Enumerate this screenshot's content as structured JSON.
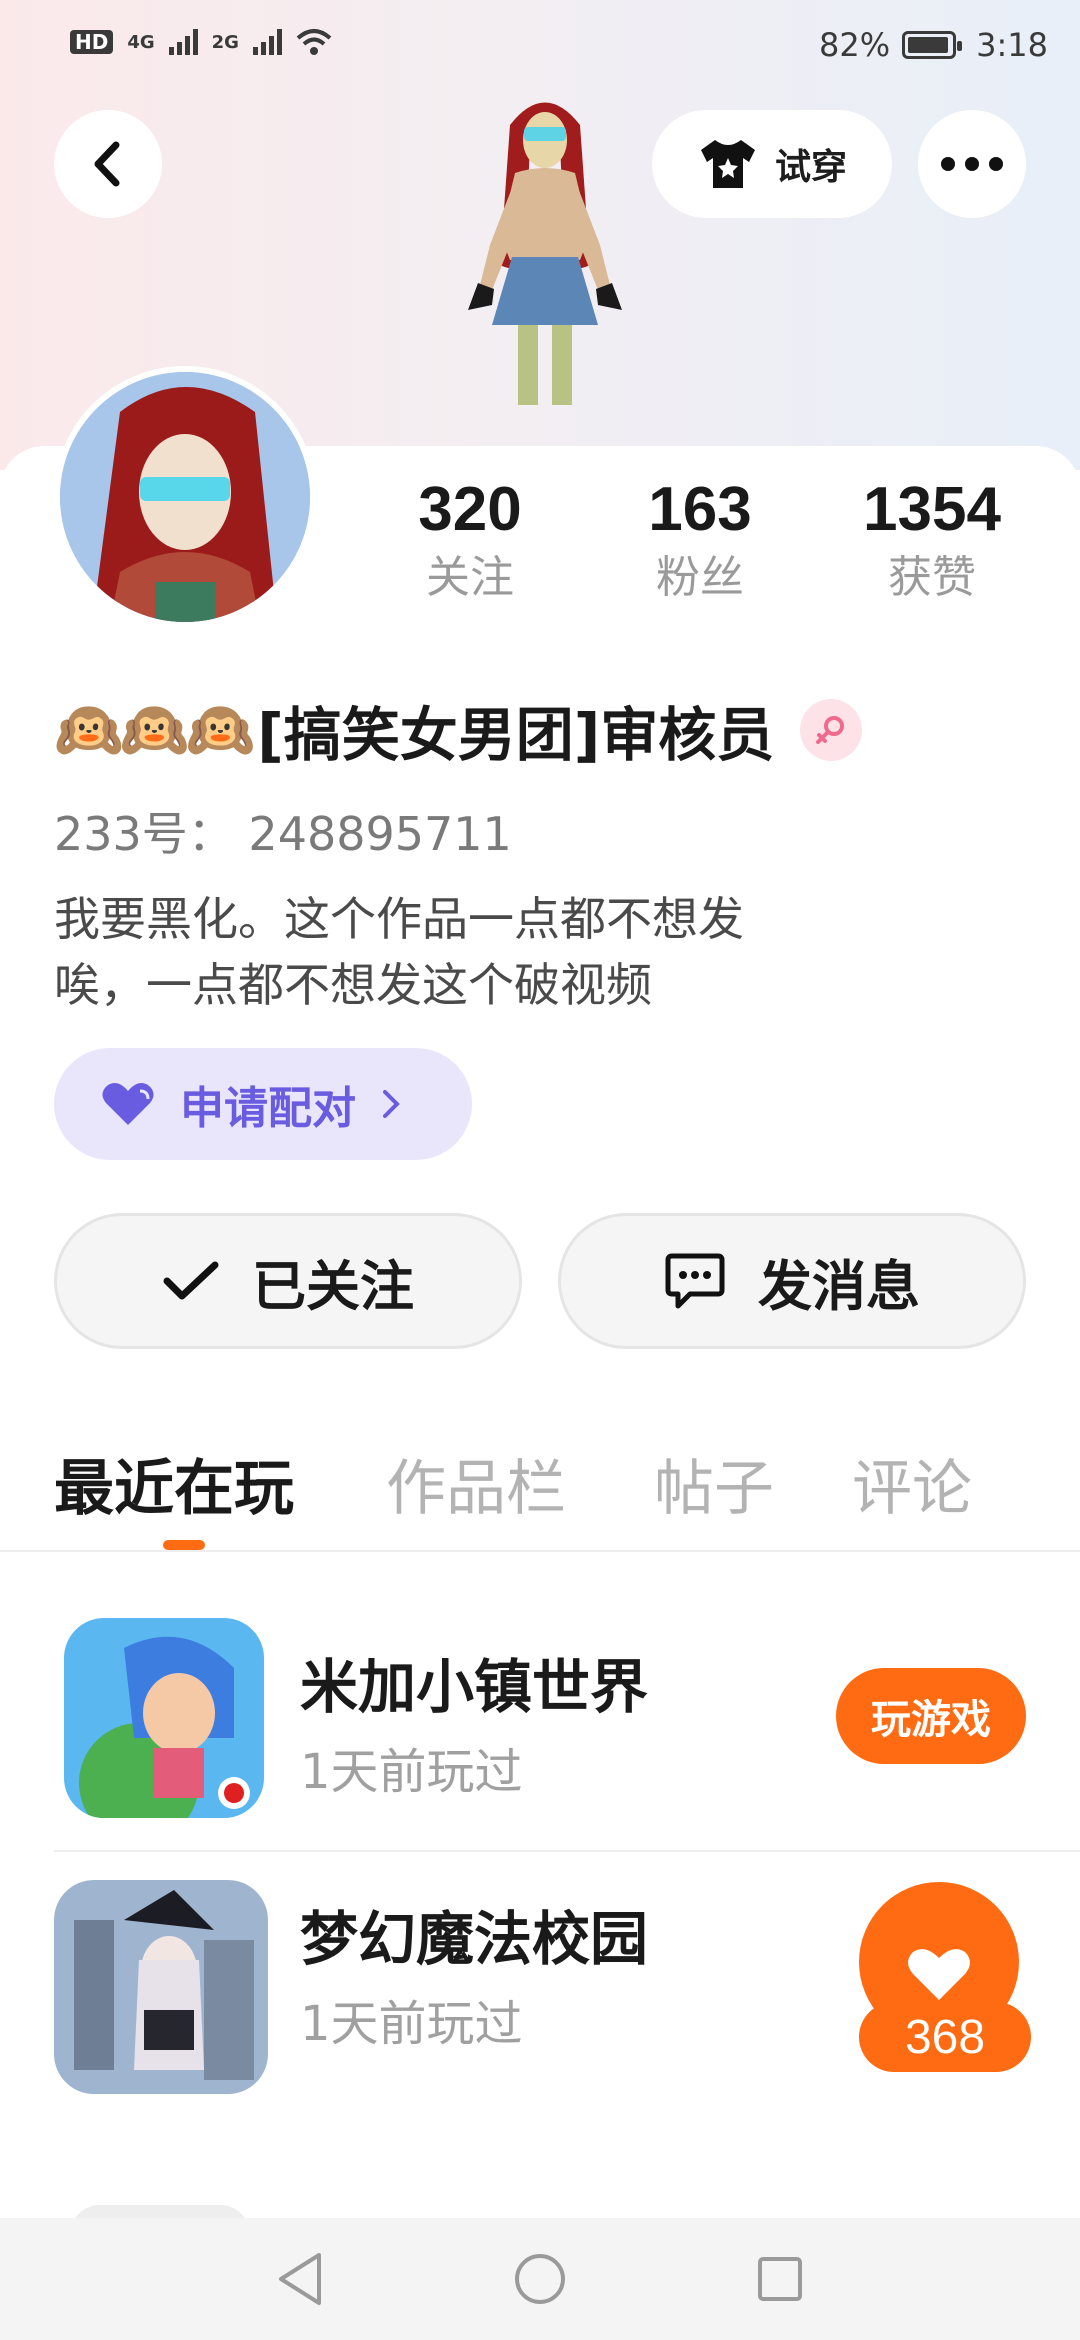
{
  "status_bar": {
    "hd": "HD",
    "sim1": "4G",
    "sim2": "2G",
    "battery": "82%",
    "battery_level": 0.82,
    "time": "3:18"
  },
  "header": {
    "back_icon": "chevron-left-icon",
    "tryon_label": "试穿",
    "tryon_icon": "tshirt-icon",
    "more_icon": "more-dots-icon"
  },
  "stats": [
    {
      "value": "320",
      "label": "关注"
    },
    {
      "value": "163",
      "label": "粉丝"
    },
    {
      "value": "1354",
      "label": "获赞"
    }
  ],
  "profile": {
    "name_prefix_emoji": "🙉🙉🙉",
    "name": "[搞笑女男团]审核员",
    "gender_icon": "female-icon",
    "uid": "233号：  248895711",
    "bio_line1": "我要黑化。这个作品一点都不想发",
    "bio_line2": "唉，一点都不想发这个破视频",
    "pair_label": "申请配对",
    "pair_icon": "heart-icon"
  },
  "actions": {
    "followed_label": "已关注",
    "message_label": "发消息"
  },
  "tabs": [
    {
      "label": "最近在玩",
      "active": true
    },
    {
      "label": "作品栏",
      "active": false
    },
    {
      "label": "帖子",
      "active": false
    },
    {
      "label": "评论",
      "active": false
    }
  ],
  "games": [
    {
      "name": "米加小镇世界",
      "time": "1天前玩过",
      "button": "玩游戏"
    },
    {
      "name": "梦幻魔法校园",
      "time": "1天前玩过",
      "likes": "368"
    }
  ],
  "colors": {
    "accent": "#ff6b12",
    "pair_bg": "#e9e6fb",
    "pair_text": "#6a5ce0"
  }
}
